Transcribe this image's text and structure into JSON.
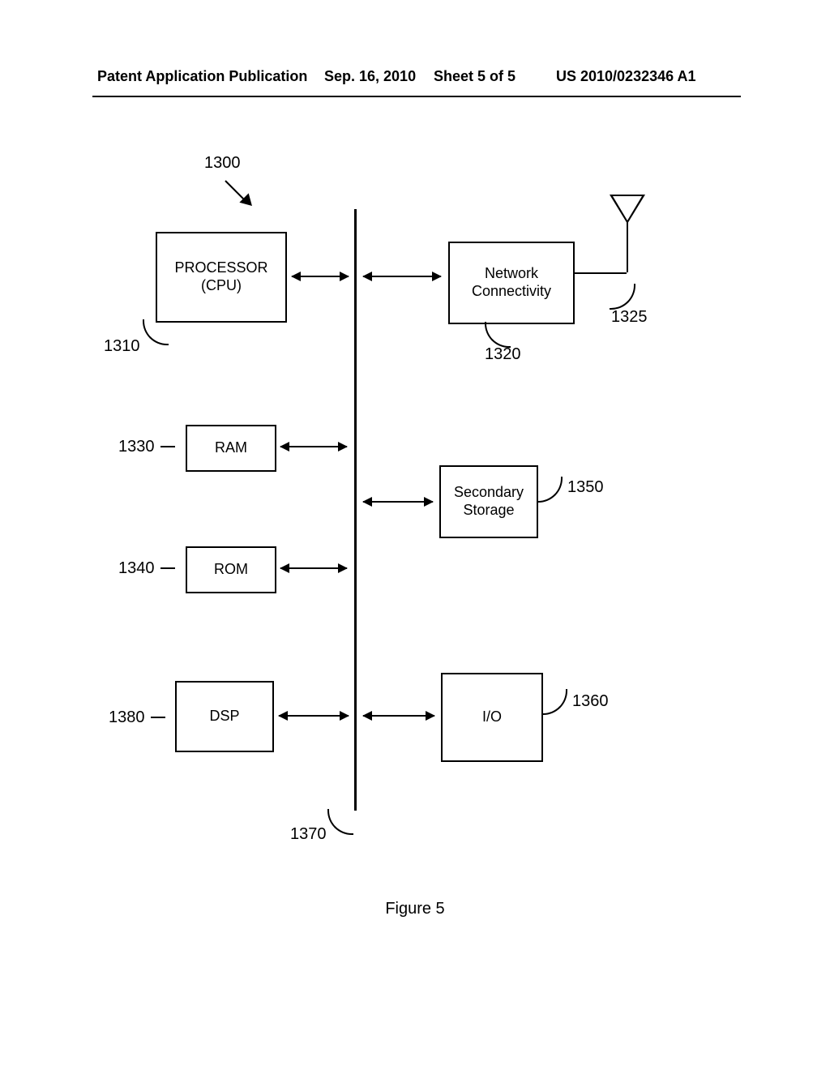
{
  "header": {
    "publication": "Patent Application Publication",
    "date": "Sep. 16, 2010",
    "sheet": "Sheet 5 of 5",
    "docnumber": "US 2010/0232346 A1"
  },
  "figure": {
    "caption": "Figure 5",
    "overall_ref": "1300",
    "blocks": {
      "processor": {
        "label": "PROCESSOR\n(CPU)",
        "ref": "1310"
      },
      "network": {
        "label": "Network\nConnectivity",
        "ref": "1320"
      },
      "antenna": {
        "ref": "1325"
      },
      "ram": {
        "label": "RAM",
        "ref": "1330"
      },
      "rom": {
        "label": "ROM",
        "ref": "1340"
      },
      "secondary": {
        "label": "Secondary\nStorage",
        "ref": "1350"
      },
      "io": {
        "label": "I/O",
        "ref": "1360"
      },
      "bus": {
        "ref": "1370"
      },
      "dsp": {
        "label": "DSP",
        "ref": "1380"
      }
    }
  }
}
